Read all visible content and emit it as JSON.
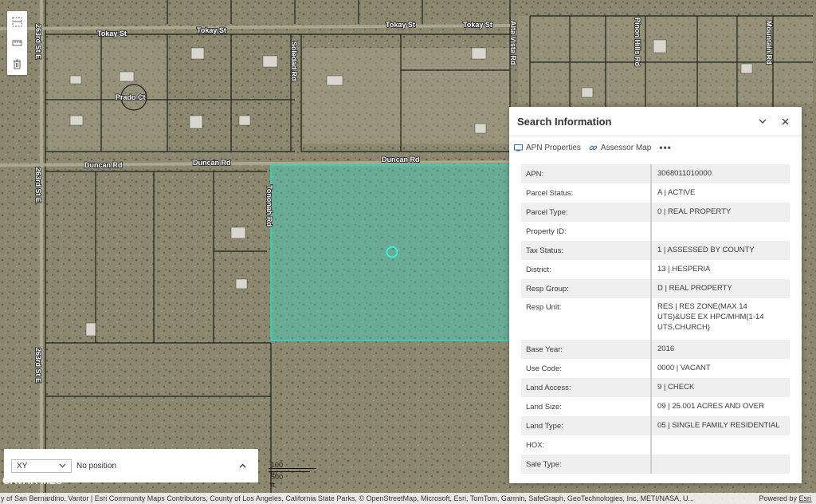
{
  "map": {
    "road_labels": {
      "tokay_1": "Tokay St",
      "tokay_2": "Tokay St",
      "tokay_3": "Tokay St",
      "tokay_4": "Tokay St",
      "duncan_1": "Duncan Rd",
      "duncan_2": "Duncan Rd",
      "duncan_3": "Duncan Rd",
      "prado": "Prado Ct",
      "soledad": "Soledad Rd",
      "tononah": "Tononah Rd",
      "alta_vista": "Alta Vista Rd",
      "pinon_hills": "Pinon Hills Rd",
      "mountain": "Mountain Rd",
      "st_263_1": "263rd St E",
      "st_263_2": "263rd St E",
      "st_263_3": "263rd St E"
    },
    "parcel_color": "#3fd6c0",
    "imagery_color": "#8b876f"
  },
  "toolbar": {
    "tools": [
      "select-tool-icon",
      "measure-tool-icon",
      "trash-icon"
    ]
  },
  "panel": {
    "title": "Search Information",
    "actions": {
      "apn_properties": "APN Properties",
      "assessor_map": "Assessor Map",
      "more": "•••"
    },
    "rows": [
      {
        "label": "APN:",
        "value": "3068011010000"
      },
      {
        "label": "Parcel Status:",
        "value": "A | ACTIVE"
      },
      {
        "label": "Parcel Type:",
        "value": "0 | REAL PROPERTY"
      },
      {
        "label": "Property ID:",
        "value": ""
      },
      {
        "label": "Tax Status:",
        "value": "1 | ASSESSED BY COUNTY"
      },
      {
        "label": "District:",
        "value": "13 | HESPERIA"
      },
      {
        "label": "Resp Group:",
        "value": "D | REAL PROPERTY"
      },
      {
        "label": "Resp Unit:",
        "value": "RES | RES ZONE(MAX 14 UTS)&USE EX HPC/MHM(1-14 UTS,CHURCH)"
      },
      {
        "label": "Base Year:",
        "value": "2016"
      },
      {
        "label": "Use Code:",
        "value": "0000 | VACANT"
      },
      {
        "label": "Land Access:",
        "value": "9 | CHECK"
      },
      {
        "label": "Land Size:",
        "value": "09 | 25.001 ACRES AND OVER"
      },
      {
        "label": "Land Type:",
        "value": "05 | SINGLE FAMILY RESIDENTIAL"
      },
      {
        "label": "HOX:",
        "value": ""
      },
      {
        "label": "Sale Type:",
        "value": ""
      }
    ]
  },
  "coords": {
    "format": "XY",
    "position": "No position"
  },
  "scale": {
    "metric": "100 m",
    "imperial": "500 ft"
  },
  "watermark": "CAVAR MLS",
  "attribution": {
    "text": "y of San Bernardino, Vantor | Esri Community Maps Contributors, County of Los Angeles, California State Parks, © OpenStreetMap, Microsoft, Esri, TomTom, Garmin, SafeGraph, GeoTechnologies, Inc, METI/NASA, U...",
    "powered_by": "Powered by",
    "esri_link": "Esri"
  }
}
